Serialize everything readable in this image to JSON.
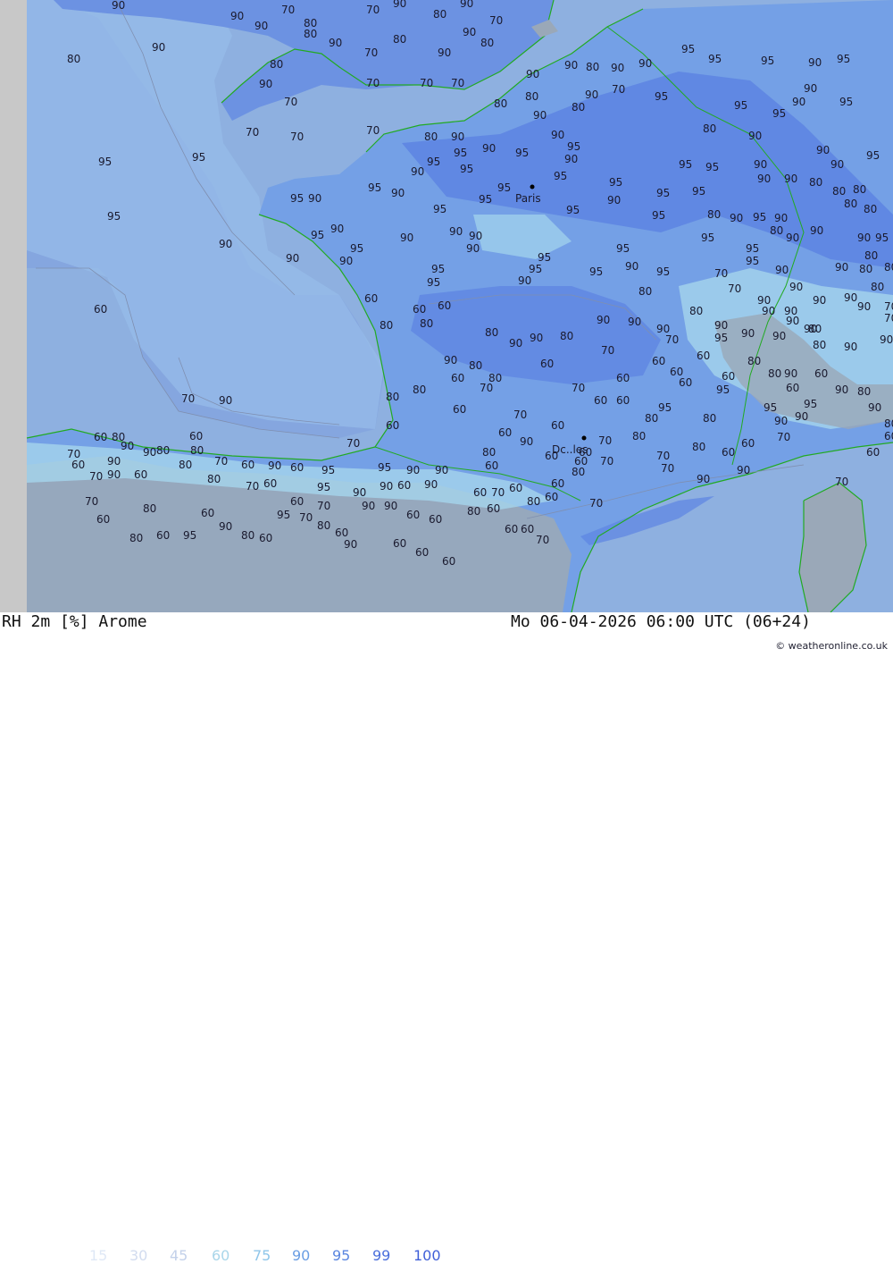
{
  "footer": {
    "title": "RH 2m [%] Arome",
    "timestamp": "Mo 06-04-2026 06:00 UTC (06+24)",
    "credit": "© weatheronline.co.uk"
  },
  "legend": [
    {
      "label": "15",
      "color": "#dfe8f6"
    },
    {
      "label": "30",
      "color": "#d2dcef"
    },
    {
      "label": "45",
      "color": "#c3d1ea"
    },
    {
      "label": "60",
      "color": "#a9d6ea"
    },
    {
      "label": "75",
      "color": "#8fc6ea"
    },
    {
      "label": "90",
      "color": "#6a9ee4"
    },
    {
      "label": "95",
      "color": "#5a86e0"
    },
    {
      "label": "99",
      "color": "#4a6fdc"
    },
    {
      "label": "100",
      "color": "#3f5fd8"
    }
  ],
  "colors": {
    "sea": "#8eb0e0",
    "land_high": "#78a0e6",
    "land_very_high": "#5d84e2",
    "land_mid": "#a5d5ec",
    "land_low": "#9aa8b8",
    "coast": "#22aa22",
    "border": "#9a9a9a"
  },
  "cities": [
    {
      "name": "Paris"
    },
    {
      "name": "Dc..les"
    }
  ],
  "labels": [
    "90",
    "90",
    "90",
    "70",
    "80",
    "70",
    "90",
    "80",
    "90",
    "70",
    "80",
    "90",
    "70",
    "80",
    "90",
    "90",
    "80",
    "90",
    "80",
    "80",
    "90",
    "70",
    "70",
    "70",
    "70",
    "80",
    "90",
    "80",
    "90",
    "80",
    "90",
    "90",
    "90",
    "70",
    "80",
    "90",
    "95",
    "95",
    "95",
    "95",
    "90",
    "95",
    "95",
    "90",
    "95",
    "95",
    "90",
    "80",
    "90",
    "90",
    "95",
    "90",
    "90",
    "95",
    "95",
    "90",
    "90",
    "80",
    "80",
    "80",
    "80",
    "80",
    "70",
    "70",
    "70",
    "80",
    "90",
    "90",
    "95",
    "90",
    "95",
    "90",
    "95",
    "95",
    "95",
    "90",
    "95",
    "95",
    "95",
    "95",
    "95",
    "95",
    "90",
    "95",
    "95",
    "80",
    "90",
    "95",
    "90",
    "80",
    "90",
    "90",
    "95",
    "95",
    "90",
    "95",
    "95",
    "95",
    "90",
    "95",
    "90",
    "90",
    "95",
    "95",
    "90",
    "95",
    "90",
    "90",
    "90",
    "95",
    "90",
    "90",
    "90",
    "95",
    "95",
    "90",
    "95",
    "95",
    "95",
    "95",
    "90",
    "95",
    "95",
    "95",
    "90",
    "90",
    "80",
    "80",
    "80",
    "80",
    "70",
    "70",
    "90",
    "90",
    "90",
    "90",
    "90",
    "90",
    "90",
    "90",
    "80",
    "70",
    "70",
    "60",
    "60",
    "60",
    "60",
    "80",
    "80",
    "80",
    "90",
    "90",
    "80",
    "90",
    "90",
    "90",
    "70",
    "80",
    "90",
    "95",
    "90",
    "90",
    "90",
    "80",
    "80",
    "90",
    "90",
    "90",
    "80",
    "60",
    "80",
    "70",
    "60",
    "70",
    "60",
    "60",
    "60",
    "60",
    "60",
    "80",
    "80",
    "60",
    "90",
    "60",
    "90",
    "80",
    "70",
    "90",
    "80",
    "80",
    "70",
    "60",
    "60",
    "60",
    "95",
    "95",
    "80",
    "95",
    "90",
    "90",
    "95",
    "90",
    "80",
    "60",
    "60",
    "60",
    "70",
    "60",
    "80",
    "60",
    "90",
    "60",
    "60",
    "70",
    "80",
    "70",
    "80",
    "60",
    "60",
    "70",
    "70",
    "60",
    "80",
    "90",
    "90",
    "80",
    "60",
    "80",
    "70",
    "90",
    "60",
    "70",
    "90",
    "60",
    "80",
    "70",
    "60",
    "90",
    "60",
    "95",
    "95",
    "90",
    "90",
    "80",
    "60",
    "60",
    "70",
    "70",
    "90",
    "90",
    "60",
    "80",
    "70",
    "60",
    "95",
    "90",
    "90",
    "60",
    "90",
    "60",
    "70",
    "60",
    "80",
    "60",
    "60",
    "70",
    "80",
    "70",
    "70",
    "80",
    "60",
    "60",
    "70",
    "90",
    "90",
    "60",
    "60",
    "80",
    "60",
    "60",
    "80",
    "60",
    "95",
    "90",
    "80",
    "60",
    "95",
    "70",
    "80",
    "60",
    "90",
    "60",
    "60",
    "60",
    "60",
    "60",
    "70"
  ]
}
